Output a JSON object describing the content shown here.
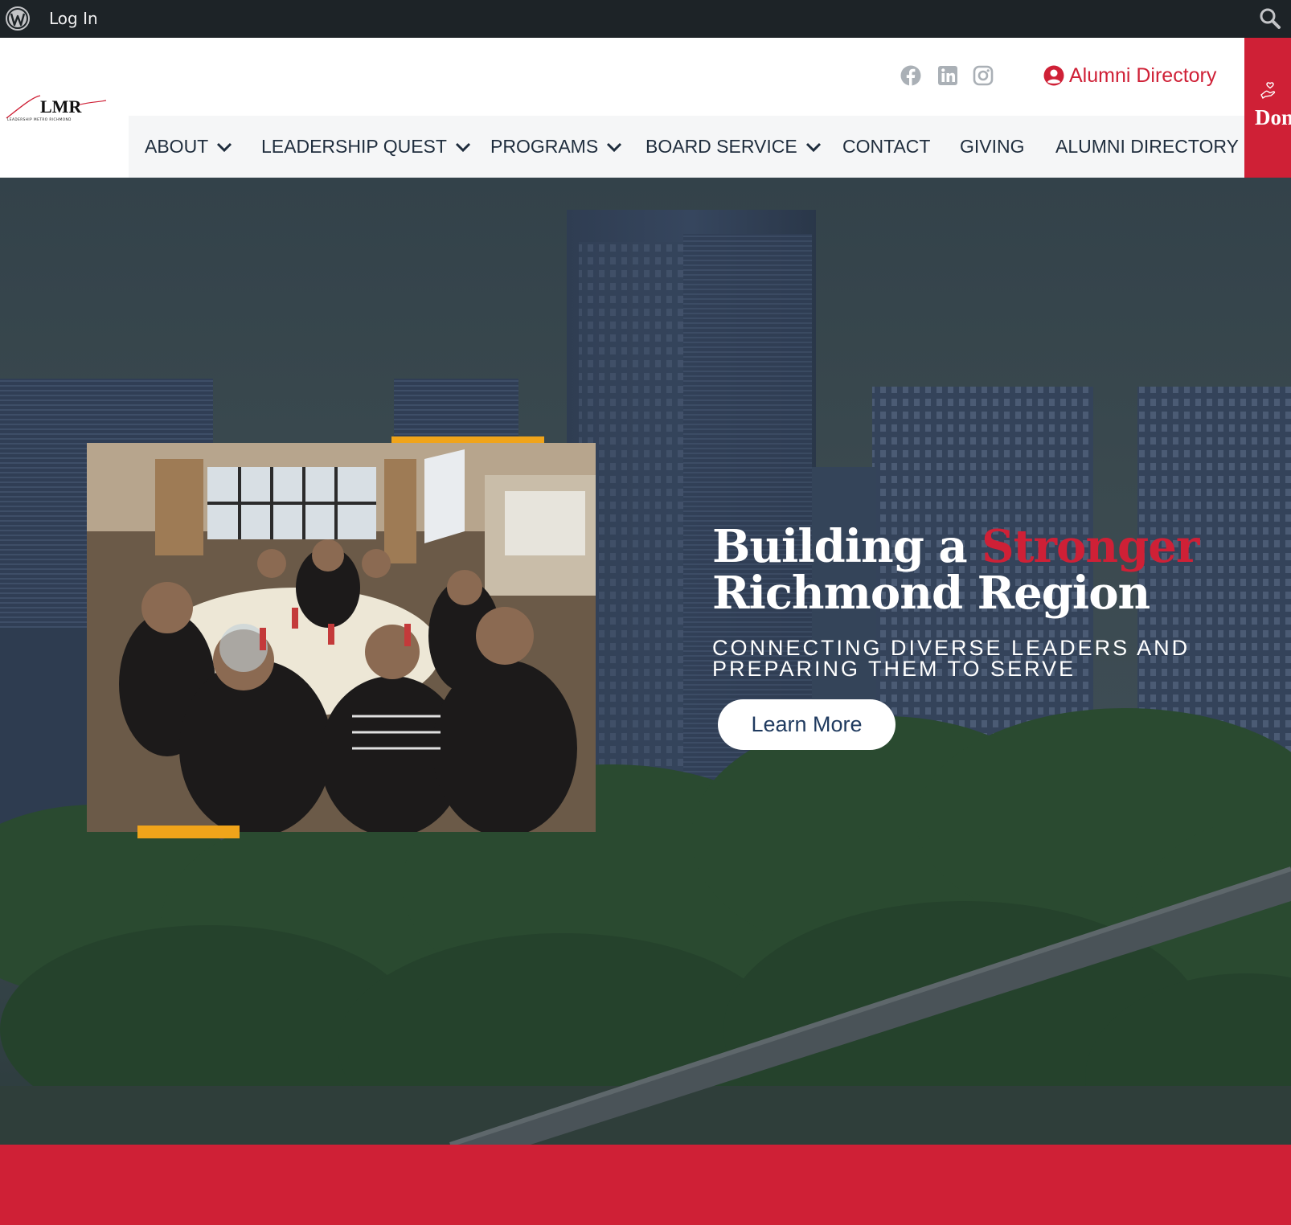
{
  "adminbar": {
    "login_label": "Log In",
    "icons": [
      "wordpress-icon",
      "search-icon"
    ]
  },
  "header": {
    "logo_text": "LMR",
    "logo_tagline": "LEADERSHIP METRO RICHMOND",
    "social_icons": [
      "facebook-icon",
      "linkedin-icon",
      "instagram-icon"
    ],
    "alumni_link": "Alumni Directory",
    "donate_label": "Donate"
  },
  "nav": {
    "items": [
      {
        "label": "ABOUT",
        "has_dropdown": true
      },
      {
        "label": "LEADERSHIP QUEST",
        "has_dropdown": true
      },
      {
        "label": "PROGRAMS",
        "has_dropdown": true
      },
      {
        "label": "BOARD SERVICE",
        "has_dropdown": true
      },
      {
        "label": "CONTACT",
        "has_dropdown": false
      },
      {
        "label": "GIVING",
        "has_dropdown": false
      },
      {
        "label": "ALUMNI DIRECTORY",
        "has_dropdown": false
      }
    ]
  },
  "hero": {
    "headline_part1": "Building a ",
    "headline_accent": "Stronger",
    "headline_part2": "Richmond Region",
    "subline": "CONNECTING DIVERSE LEADERS AND PREPARING THEM TO SERVE",
    "cta_label": "Learn More"
  },
  "colors": {
    "brand_red": "#cf2036",
    "accent_gold": "#f0a41a",
    "admin_bar": "#1d2327",
    "nav_text": "#1f2d3d"
  }
}
